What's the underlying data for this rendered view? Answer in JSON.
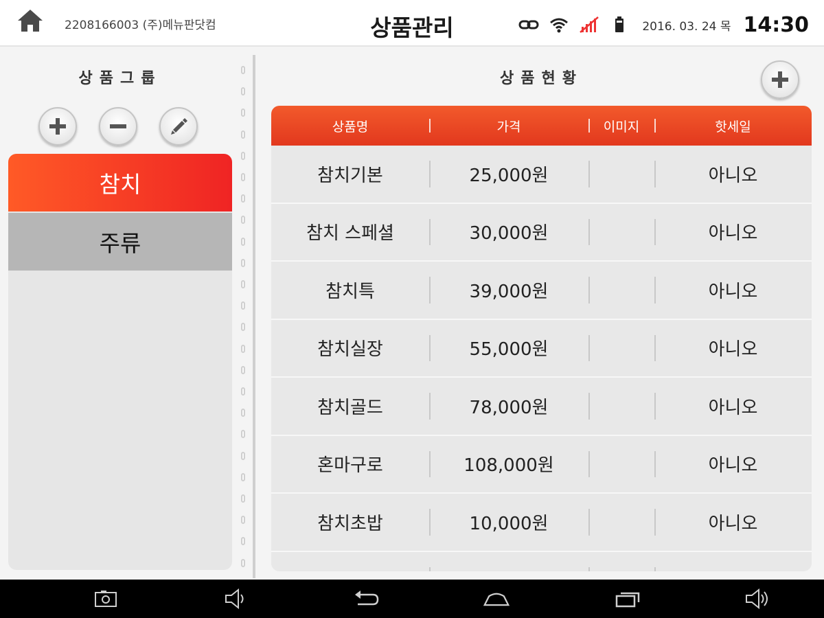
{
  "header": {
    "merchant": "2208166003 (주)메뉴판닷컴",
    "title": "상품관리",
    "date": "2016. 03. 24 목",
    "time": "14:30"
  },
  "icons": {
    "home": "home-icon",
    "link": "link-icon",
    "wifi": "wifi-icon",
    "no_signal": "no-signal-icon",
    "battery": "battery-icon",
    "add": "plus-icon",
    "remove": "minus-icon",
    "edit": "pencil-icon",
    "nav": [
      "camera-icon",
      "volume-down-icon",
      "back-icon",
      "home-icon",
      "recent-apps-icon",
      "volume-up-icon"
    ]
  },
  "colors": {
    "accent": "#ef3a22",
    "active_group_start": "#ff5a26",
    "active_group_end": "#ef2424"
  },
  "groups": {
    "title": "상품그룹",
    "items": [
      {
        "label": "참치",
        "active": true
      },
      {
        "label": "주류",
        "active": false
      }
    ]
  },
  "products": {
    "title": "상품현황",
    "columns": [
      "상품명",
      "가격",
      "이미지",
      "핫세일"
    ],
    "rows": [
      {
        "name": "참치기본",
        "price": "25,000원",
        "image": "",
        "hot": "아니오"
      },
      {
        "name": "참치 스페셜",
        "price": "30,000원",
        "image": "",
        "hot": "아니오"
      },
      {
        "name": "참치특",
        "price": "39,000원",
        "image": "",
        "hot": "아니오"
      },
      {
        "name": "참치실장",
        "price": "55,000원",
        "image": "",
        "hot": "아니오"
      },
      {
        "name": "참치골드",
        "price": "78,000원",
        "image": "",
        "hot": "아니오"
      },
      {
        "name": "혼마구로",
        "price": "108,000원",
        "image": "",
        "hot": "아니오"
      },
      {
        "name": "참치초밥",
        "price": "10,000원",
        "image": "",
        "hot": "아니오"
      }
    ]
  }
}
